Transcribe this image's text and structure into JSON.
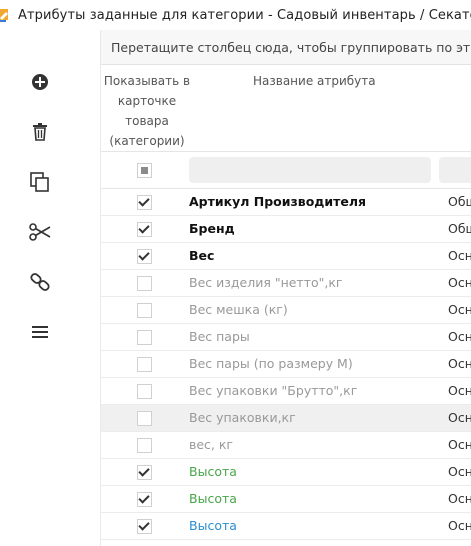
{
  "window": {
    "title": "Атрибуты заданные для категории - Садовый инвентарь / Секаторы"
  },
  "toolbar": {
    "items": [
      "plus-circle-icon",
      "trash-icon",
      "copy-icon",
      "scissors-icon",
      "link-icon",
      "menu-icon"
    ]
  },
  "grid": {
    "group_panel_text": "Перетащите столбец сюда, чтобы группировать по этому",
    "columns": {
      "show": "Показывать в карточке товара (категории)",
      "name": "Название атрибута"
    },
    "rows": [
      {
        "checked": true,
        "name": "Артикул Производителя",
        "group": "Общ",
        "style": "dark"
      },
      {
        "checked": true,
        "name": "Бренд",
        "group": "Общ",
        "style": "dark"
      },
      {
        "checked": true,
        "name": "Вес",
        "group": "Осн",
        "style": "dark"
      },
      {
        "checked": false,
        "name": "Вес изделия \"нетто\",кг",
        "group": "Осн",
        "style": "gray"
      },
      {
        "checked": false,
        "name": "Вес мешка (кг)",
        "group": "Осн",
        "style": "gray"
      },
      {
        "checked": false,
        "name": "Вес пары",
        "group": "Осн",
        "style": "gray"
      },
      {
        "checked": false,
        "name": "Вес пары (по размеру М)",
        "group": "Осн",
        "style": "gray"
      },
      {
        "checked": false,
        "name": "Вес упаковки \"Брутто\",кг",
        "group": "Осн",
        "style": "gray"
      },
      {
        "checked": false,
        "name": "Вес упаковки,кг",
        "group": "Осн",
        "style": "gray",
        "highlight": true
      },
      {
        "checked": false,
        "name": "вес, кг",
        "group": "Осн",
        "style": "gray"
      },
      {
        "checked": true,
        "name": "Высота",
        "group": "Осн",
        "style": "green"
      },
      {
        "checked": true,
        "name": "Высота",
        "group": "Осн",
        "style": "green"
      },
      {
        "checked": true,
        "name": "Высота",
        "group": "Осн",
        "style": "blue"
      }
    ]
  },
  "colors": {
    "green": "#4aa64a",
    "blue": "#2b8fd1",
    "gray": "#999999"
  }
}
